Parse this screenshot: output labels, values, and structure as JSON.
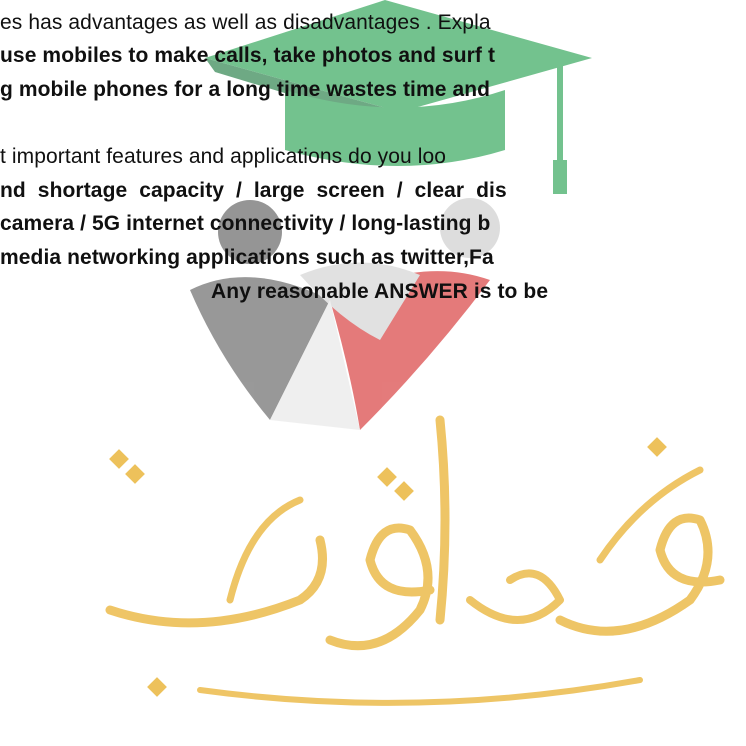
{
  "document": {
    "lines": [
      "es has advantages as well as disadvantages . Expla",
      "use mobiles to make calls, take photos and surf t",
      "g mobile phones for a long time wastes time and",
      "t important features and applications do you loo",
      "nd shortage capacity /  large screen / clear dis",
      "camera / 5G internet connectivity / long-lasting b",
      "media networking applications such as twitter,Fa",
      "Any reasonable ANSWER is to be"
    ]
  },
  "watermark": {
    "logo_icon": "graduation-cap-with-figures-logo-icon",
    "calligraphy": "صفوة معلمي الكويت",
    "colors": {
      "cap": "#1f9d4a",
      "cap_dark": "#16753a",
      "figure_left": "#555555",
      "figure_right": "#d42a2a",
      "figure_center": "#b9b9b9",
      "calligraphy": "#e9b233"
    }
  }
}
